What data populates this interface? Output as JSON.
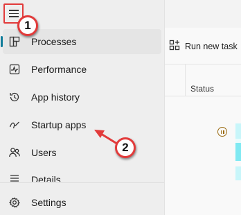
{
  "sidebar": {
    "items": [
      {
        "label": "Processes",
        "icon": "processes-icon"
      },
      {
        "label": "Performance",
        "icon": "performance-icon"
      },
      {
        "label": "App history",
        "icon": "app-history-icon"
      },
      {
        "label": "Startup apps",
        "icon": "startup-apps-icon"
      },
      {
        "label": "Users",
        "icon": "users-icon"
      },
      {
        "label": "Details",
        "icon": "details-icon"
      }
    ],
    "settings_label": "Settings",
    "active_index": 0
  },
  "toolbar": {
    "run_new_task_label": "Run new task"
  },
  "table": {
    "status_header": "Status"
  },
  "annotations": {
    "step1": "1",
    "step2": "2"
  },
  "colors": {
    "accent": "#107c9a",
    "annotation": "#e23b3b",
    "heat_light": "#c8f6fa",
    "heat_strong": "#7fe9f2"
  }
}
